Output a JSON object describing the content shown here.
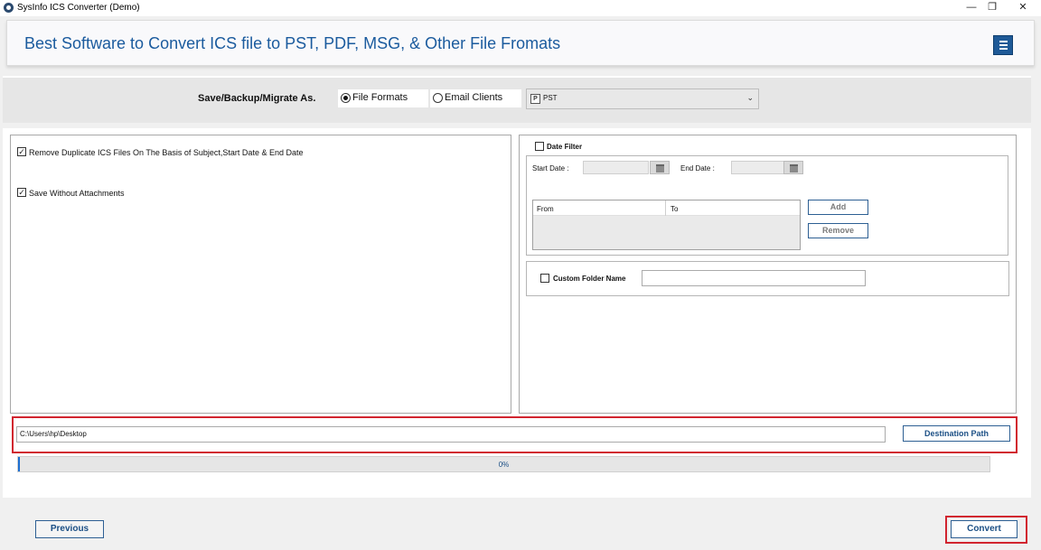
{
  "window": {
    "title": "SysInfo ICS Converter (Demo)",
    "controls": {
      "minimize": "—",
      "restore": "❐",
      "close": "✕"
    }
  },
  "header": {
    "title": "Best Software to Convert ICS file to PST, PDF, MSG, & Other File Fromats",
    "menu_icon": "hamburger-icon"
  },
  "save_options": {
    "label": "Save/Backup/Migrate As.",
    "radios": [
      {
        "label": "File Formats",
        "selected": true
      },
      {
        "label": "Email Clients",
        "selected": false
      }
    ],
    "format_select": {
      "value": "PST",
      "icon_text": "P"
    }
  },
  "options": {
    "remove_duplicates": {
      "label": "Remove Duplicate ICS Files On The Basis of Subject,Start Date & End Date",
      "checked": true
    },
    "save_without_attachments": {
      "label": "Save Without Attachments",
      "checked": true
    }
  },
  "date_filter": {
    "label": "Date Filter",
    "checked": false,
    "start_label": "Start Date :",
    "end_label": "End Date :",
    "columns": [
      "From",
      "To"
    ],
    "add_label": "Add",
    "remove_label": "Remove"
  },
  "custom_folder": {
    "label": "Custom Folder Name",
    "checked": false,
    "value": ""
  },
  "destination": {
    "path": "C:\\Users\\hp\\Desktop",
    "button_label": "Destination Path"
  },
  "progress": {
    "value": 0,
    "text": "0%"
  },
  "footer": {
    "previous_label": "Previous",
    "convert_label": "Convert"
  },
  "colors": {
    "title_blue": "#1b5b9e",
    "button_border": "#2d5f93",
    "highlight_red": "#d1242f"
  }
}
